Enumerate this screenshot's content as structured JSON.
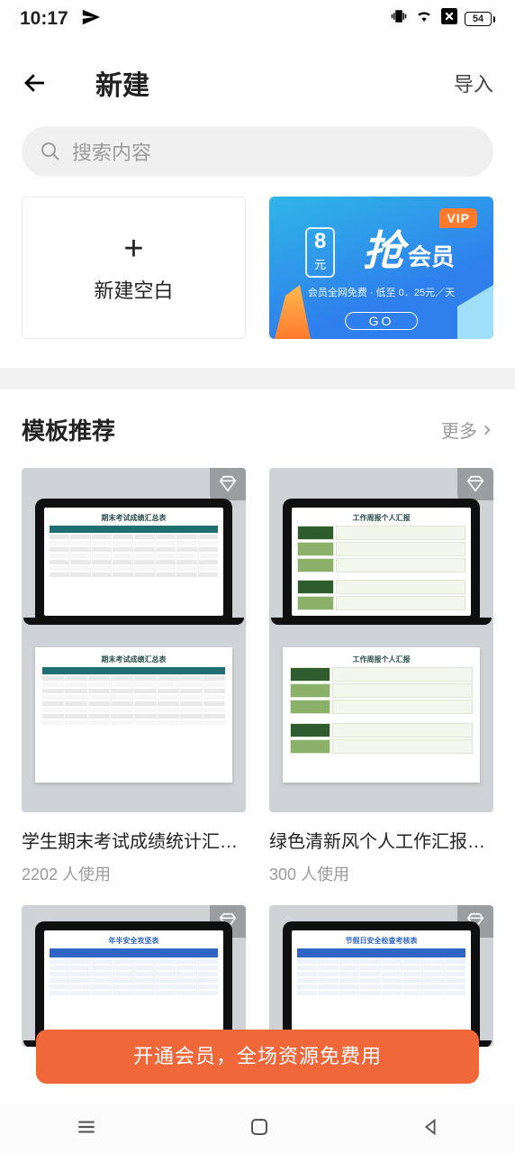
{
  "status": {
    "time": "10:17",
    "battery": "54"
  },
  "app_bar": {
    "title": "新建",
    "import": "导入"
  },
  "search": {
    "placeholder": "搜索内容"
  },
  "new_blank": {
    "label": "新建空白"
  },
  "vip_banner": {
    "badge": "VIP",
    "price_num": "8",
    "price_unit": "元",
    "headline_big": "抢",
    "headline_rest": "会员",
    "subline": "会员全网免费 · 低至 0．25元／天",
    "go": "GO"
  },
  "recommend": {
    "title": "模板推荐",
    "more": "更多"
  },
  "templates": [
    {
      "title": "学生期末考试成绩统计汇…",
      "usage": "2202 人使用",
      "mini_title_1": "期末考试成绩汇总表",
      "mini_title_2": "期末考试成绩汇总表"
    },
    {
      "title": "绿色清新风个人工作汇报…",
      "usage": "300 人使用",
      "mini_title_1": "工作周报个人汇报",
      "mini_title_2": "工作周报个人汇报"
    },
    {
      "title": "",
      "usage": "",
      "mini_title_1": "年半安全攻坚表"
    },
    {
      "title": "",
      "usage": "",
      "mini_title_1": "节假日安全检查考核表"
    }
  ],
  "cta": {
    "text": "开通会员，全场资源免费用"
  }
}
